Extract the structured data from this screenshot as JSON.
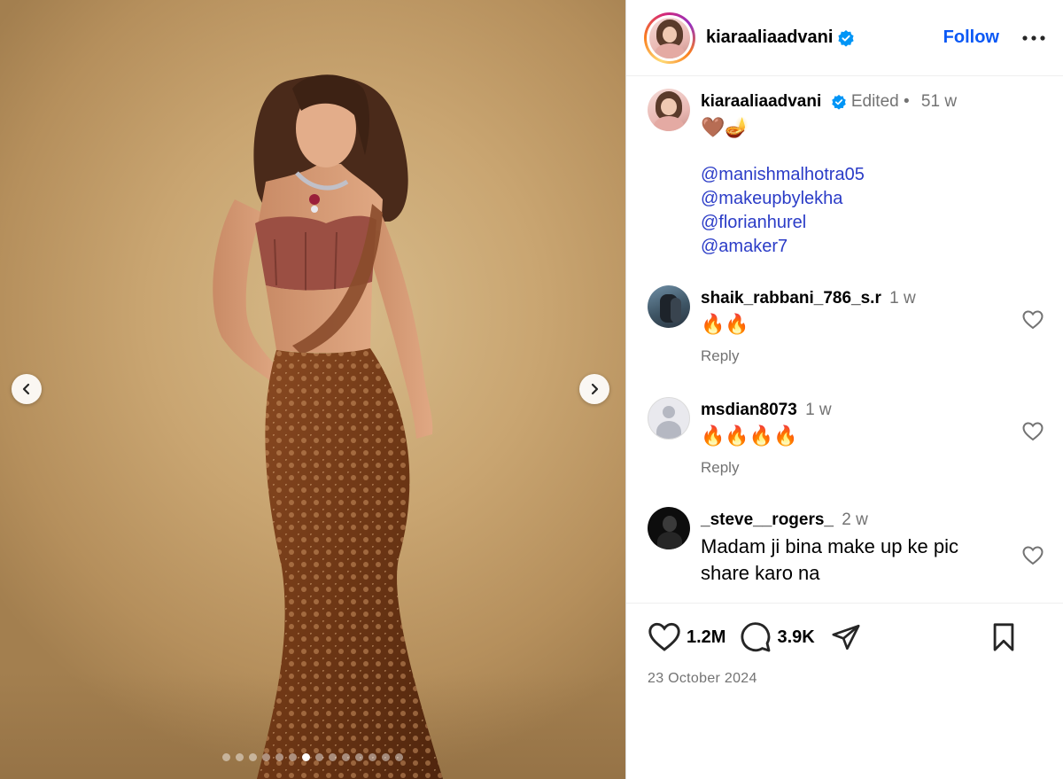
{
  "post": {
    "username": "kiaraaliaadvani",
    "follow_label": "Follow",
    "carousel": {
      "total_slides": 14,
      "active_index": 6
    }
  },
  "caption": {
    "username": "kiaraaliaadvani",
    "edited_label": "Edited",
    "separator": "•",
    "time": "51 w",
    "emoji": "🤎🪔",
    "mentions": [
      "@manishmalhotra05",
      "@makeupbylekha",
      "@florianhurel",
      "@amaker7"
    ]
  },
  "comments": [
    {
      "username": "shaik_rabbani_786_s.r",
      "time": "1 w",
      "text": "🔥🔥",
      "reply_label": "Reply"
    },
    {
      "username": "msdian8073",
      "time": "1 w",
      "text": "🔥🔥🔥🔥",
      "reply_label": "Reply"
    },
    {
      "username": "_steve__rogers_",
      "time": "2 w",
      "text_line1": "Madam ji bina make up ke pic",
      "text_line2": "share karo na"
    }
  ],
  "actions": {
    "likes": "1.2M",
    "comments": "3.9K",
    "date": "23 October 2024"
  },
  "colors": {
    "link": "#0a58f5",
    "mention": "#2b3cc7",
    "verified": "#0095f6",
    "muted": "#737373"
  }
}
